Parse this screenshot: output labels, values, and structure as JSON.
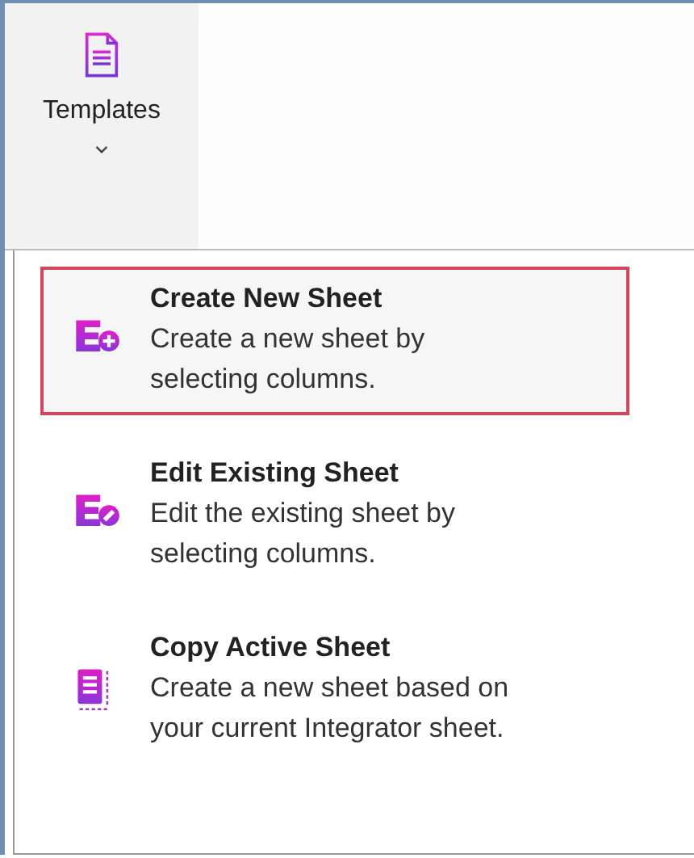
{
  "ribbon_button": {
    "label": "Templates"
  },
  "menu": {
    "items": [
      {
        "kind": "create",
        "title": "Create New Sheet",
        "description": "Create a new sheet by selecting columns.",
        "selected": true
      },
      {
        "kind": "edit",
        "title": "Edit Existing Sheet",
        "description": "Edit the existing sheet by selecting columns.",
        "selected": false
      },
      {
        "kind": "copy",
        "title": "Copy Active Sheet",
        "description": "Create a new sheet based on your current Integrator sheet.",
        "selected": false
      }
    ]
  }
}
